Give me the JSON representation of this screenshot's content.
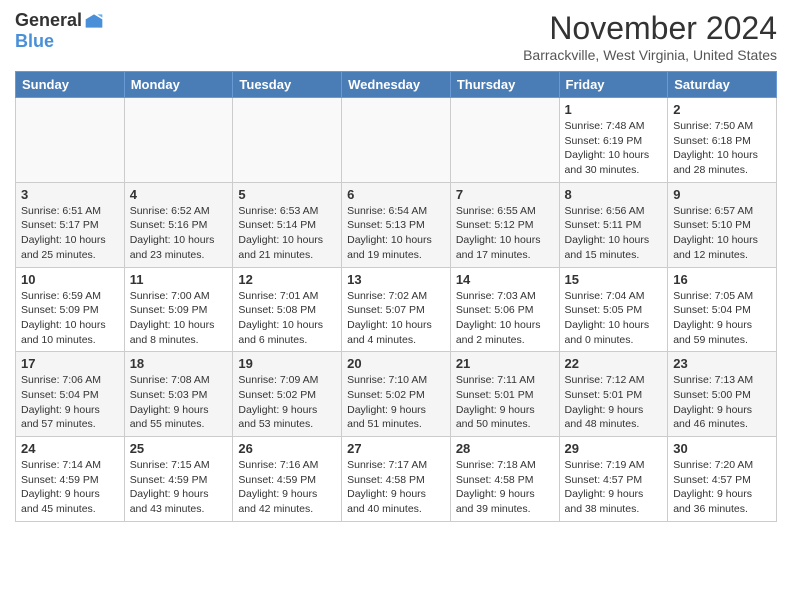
{
  "header": {
    "logo_general": "General",
    "logo_blue": "Blue",
    "month_title": "November 2024",
    "subtitle": "Barrackville, West Virginia, United States"
  },
  "days_of_week": [
    "Sunday",
    "Monday",
    "Tuesday",
    "Wednesday",
    "Thursday",
    "Friday",
    "Saturday"
  ],
  "weeks": [
    [
      {
        "day": "",
        "info": ""
      },
      {
        "day": "",
        "info": ""
      },
      {
        "day": "",
        "info": ""
      },
      {
        "day": "",
        "info": ""
      },
      {
        "day": "",
        "info": ""
      },
      {
        "day": "1",
        "info": "Sunrise: 7:48 AM\nSunset: 6:19 PM\nDaylight: 10 hours and 30 minutes."
      },
      {
        "day": "2",
        "info": "Sunrise: 7:50 AM\nSunset: 6:18 PM\nDaylight: 10 hours and 28 minutes."
      }
    ],
    [
      {
        "day": "3",
        "info": "Sunrise: 6:51 AM\nSunset: 5:17 PM\nDaylight: 10 hours and 25 minutes."
      },
      {
        "day": "4",
        "info": "Sunrise: 6:52 AM\nSunset: 5:16 PM\nDaylight: 10 hours and 23 minutes."
      },
      {
        "day": "5",
        "info": "Sunrise: 6:53 AM\nSunset: 5:14 PM\nDaylight: 10 hours and 21 minutes."
      },
      {
        "day": "6",
        "info": "Sunrise: 6:54 AM\nSunset: 5:13 PM\nDaylight: 10 hours and 19 minutes."
      },
      {
        "day": "7",
        "info": "Sunrise: 6:55 AM\nSunset: 5:12 PM\nDaylight: 10 hours and 17 minutes."
      },
      {
        "day": "8",
        "info": "Sunrise: 6:56 AM\nSunset: 5:11 PM\nDaylight: 10 hours and 15 minutes."
      },
      {
        "day": "9",
        "info": "Sunrise: 6:57 AM\nSunset: 5:10 PM\nDaylight: 10 hours and 12 minutes."
      }
    ],
    [
      {
        "day": "10",
        "info": "Sunrise: 6:59 AM\nSunset: 5:09 PM\nDaylight: 10 hours and 10 minutes."
      },
      {
        "day": "11",
        "info": "Sunrise: 7:00 AM\nSunset: 5:09 PM\nDaylight: 10 hours and 8 minutes."
      },
      {
        "day": "12",
        "info": "Sunrise: 7:01 AM\nSunset: 5:08 PM\nDaylight: 10 hours and 6 minutes."
      },
      {
        "day": "13",
        "info": "Sunrise: 7:02 AM\nSunset: 5:07 PM\nDaylight: 10 hours and 4 minutes."
      },
      {
        "day": "14",
        "info": "Sunrise: 7:03 AM\nSunset: 5:06 PM\nDaylight: 10 hours and 2 minutes."
      },
      {
        "day": "15",
        "info": "Sunrise: 7:04 AM\nSunset: 5:05 PM\nDaylight: 10 hours and 0 minutes."
      },
      {
        "day": "16",
        "info": "Sunrise: 7:05 AM\nSunset: 5:04 PM\nDaylight: 9 hours and 59 minutes."
      }
    ],
    [
      {
        "day": "17",
        "info": "Sunrise: 7:06 AM\nSunset: 5:04 PM\nDaylight: 9 hours and 57 minutes."
      },
      {
        "day": "18",
        "info": "Sunrise: 7:08 AM\nSunset: 5:03 PM\nDaylight: 9 hours and 55 minutes."
      },
      {
        "day": "19",
        "info": "Sunrise: 7:09 AM\nSunset: 5:02 PM\nDaylight: 9 hours and 53 minutes."
      },
      {
        "day": "20",
        "info": "Sunrise: 7:10 AM\nSunset: 5:02 PM\nDaylight: 9 hours and 51 minutes."
      },
      {
        "day": "21",
        "info": "Sunrise: 7:11 AM\nSunset: 5:01 PM\nDaylight: 9 hours and 50 minutes."
      },
      {
        "day": "22",
        "info": "Sunrise: 7:12 AM\nSunset: 5:01 PM\nDaylight: 9 hours and 48 minutes."
      },
      {
        "day": "23",
        "info": "Sunrise: 7:13 AM\nSunset: 5:00 PM\nDaylight: 9 hours and 46 minutes."
      }
    ],
    [
      {
        "day": "24",
        "info": "Sunrise: 7:14 AM\nSunset: 4:59 PM\nDaylight: 9 hours and 45 minutes."
      },
      {
        "day": "25",
        "info": "Sunrise: 7:15 AM\nSunset: 4:59 PM\nDaylight: 9 hours and 43 minutes."
      },
      {
        "day": "26",
        "info": "Sunrise: 7:16 AM\nSunset: 4:59 PM\nDaylight: 9 hours and 42 minutes."
      },
      {
        "day": "27",
        "info": "Sunrise: 7:17 AM\nSunset: 4:58 PM\nDaylight: 9 hours and 40 minutes."
      },
      {
        "day": "28",
        "info": "Sunrise: 7:18 AM\nSunset: 4:58 PM\nDaylight: 9 hours and 39 minutes."
      },
      {
        "day": "29",
        "info": "Sunrise: 7:19 AM\nSunset: 4:57 PM\nDaylight: 9 hours and 38 minutes."
      },
      {
        "day": "30",
        "info": "Sunrise: 7:20 AM\nSunset: 4:57 PM\nDaylight: 9 hours and 36 minutes."
      }
    ]
  ]
}
